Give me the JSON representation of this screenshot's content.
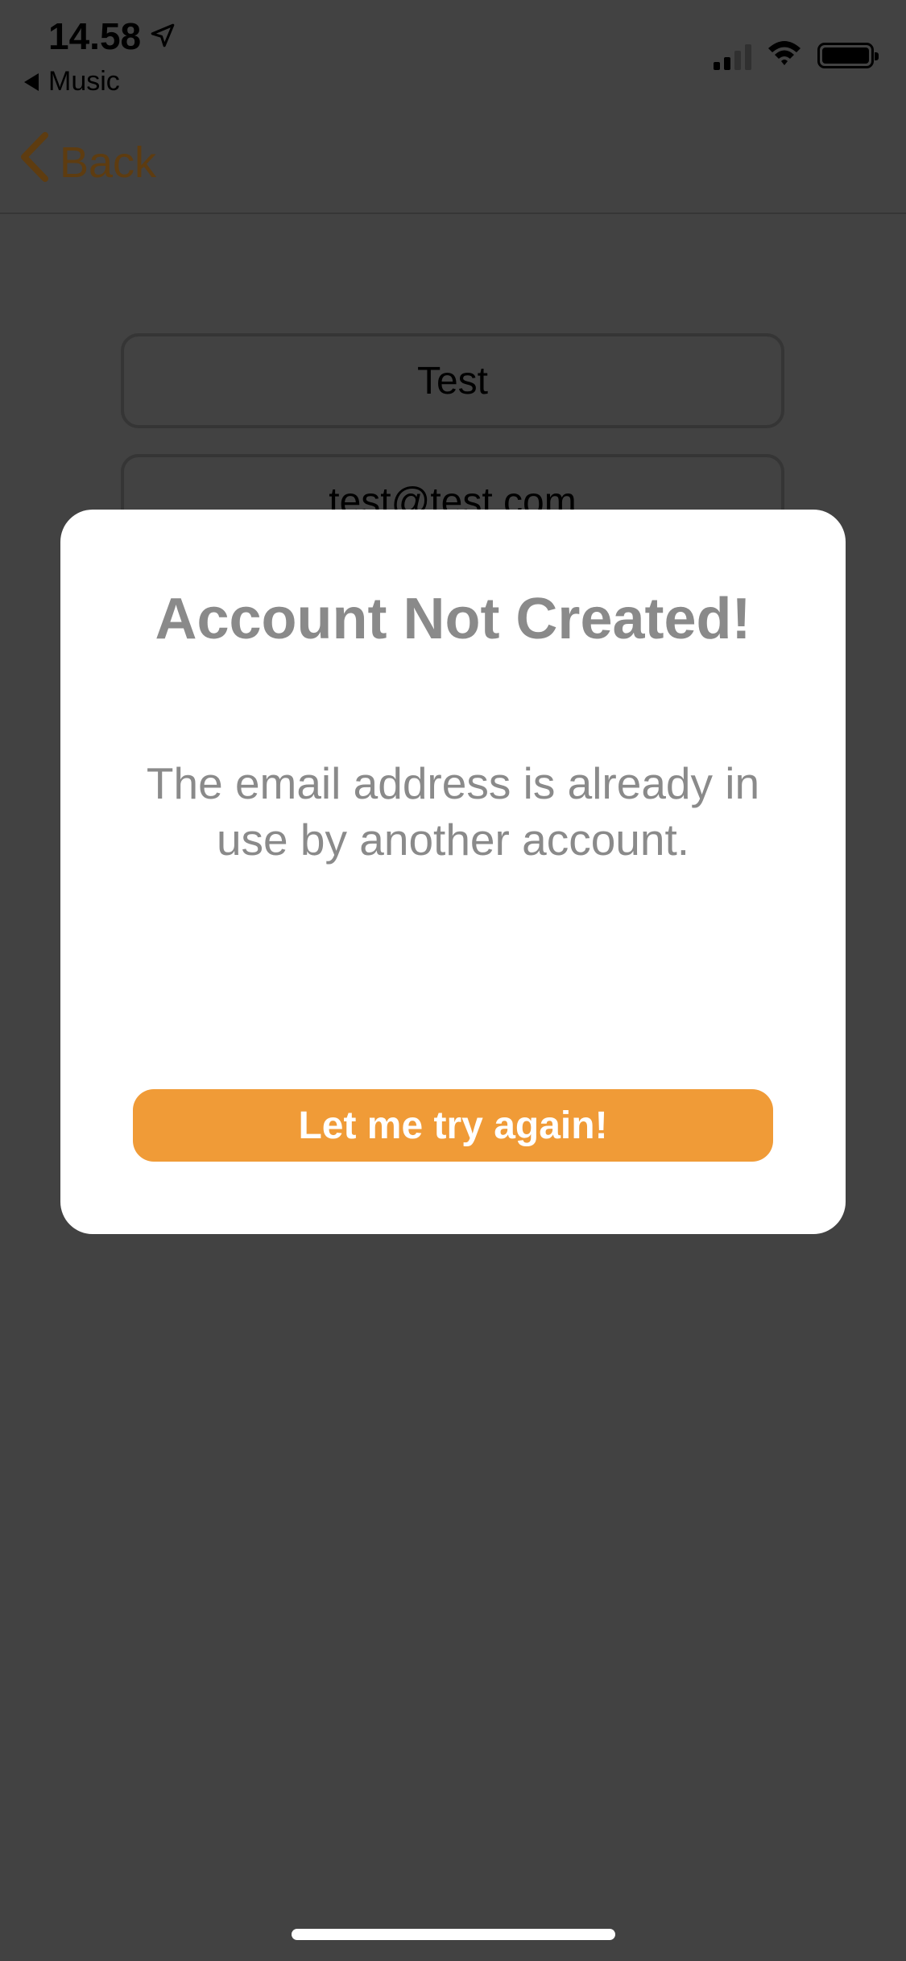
{
  "status_bar": {
    "time": "14.58",
    "back_app": "Music",
    "icons": [
      "location-arrow-icon",
      "signal-icon",
      "wifi-icon",
      "battery-icon"
    ]
  },
  "nav": {
    "back_label": "Back",
    "back_icon": "chevron-left-icon"
  },
  "form": {
    "name_value": "Test",
    "email_value": "test@test.com"
  },
  "alert": {
    "title": "Account Not Created!",
    "message": "The email address is already in use by another account.",
    "button_label": "Let me try again!"
  },
  "colors": {
    "accent": "#f09b37",
    "overlay_background": "#424242",
    "alert_text": "#8a8a8a"
  }
}
